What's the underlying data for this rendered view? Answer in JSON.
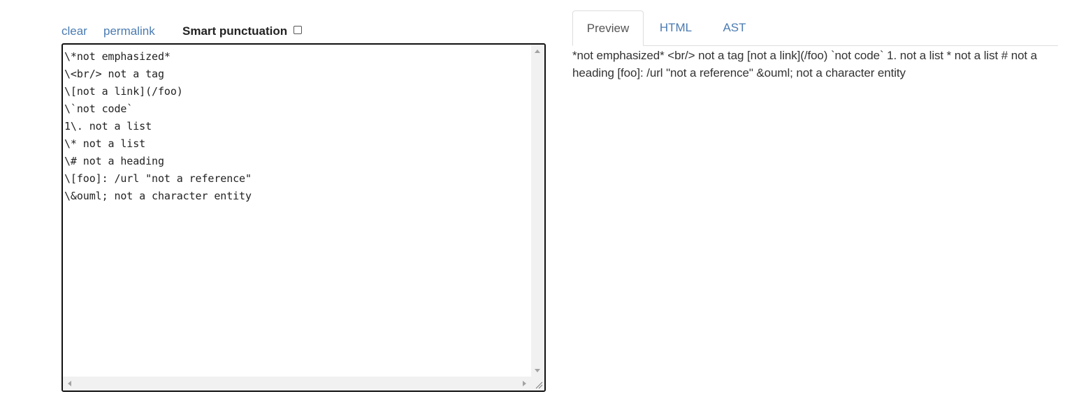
{
  "toolbar": {
    "clear_label": "clear",
    "permalink_label": "permalink",
    "smart_punctuation_label": "Smart punctuation",
    "smart_punctuation_checked": false
  },
  "editor": {
    "lines": [
      "\\*not emphasized*",
      "\\<br/> not a tag",
      "\\[not a link](/foo)",
      "\\`not code`",
      "1\\. not a list",
      "\\* not a list",
      "\\# not a heading",
      "\\[foo]: /url \"not a reference\"",
      "\\&ouml; not a character entity"
    ]
  },
  "tabs": [
    {
      "label": "Preview",
      "active": true
    },
    {
      "label": "HTML",
      "active": false
    },
    {
      "label": "AST",
      "active": false
    }
  ],
  "preview": {
    "text": "*not emphasized* <br/> not a tag [not a link](/foo) `not code` 1. not a list * not a list # not a heading [foo]: /url \"not a reference\" &ouml; not a character entity"
  },
  "colors": {
    "link": "#4a7bb1",
    "editor_border": "#111111",
    "tab_border": "#dddddd"
  }
}
